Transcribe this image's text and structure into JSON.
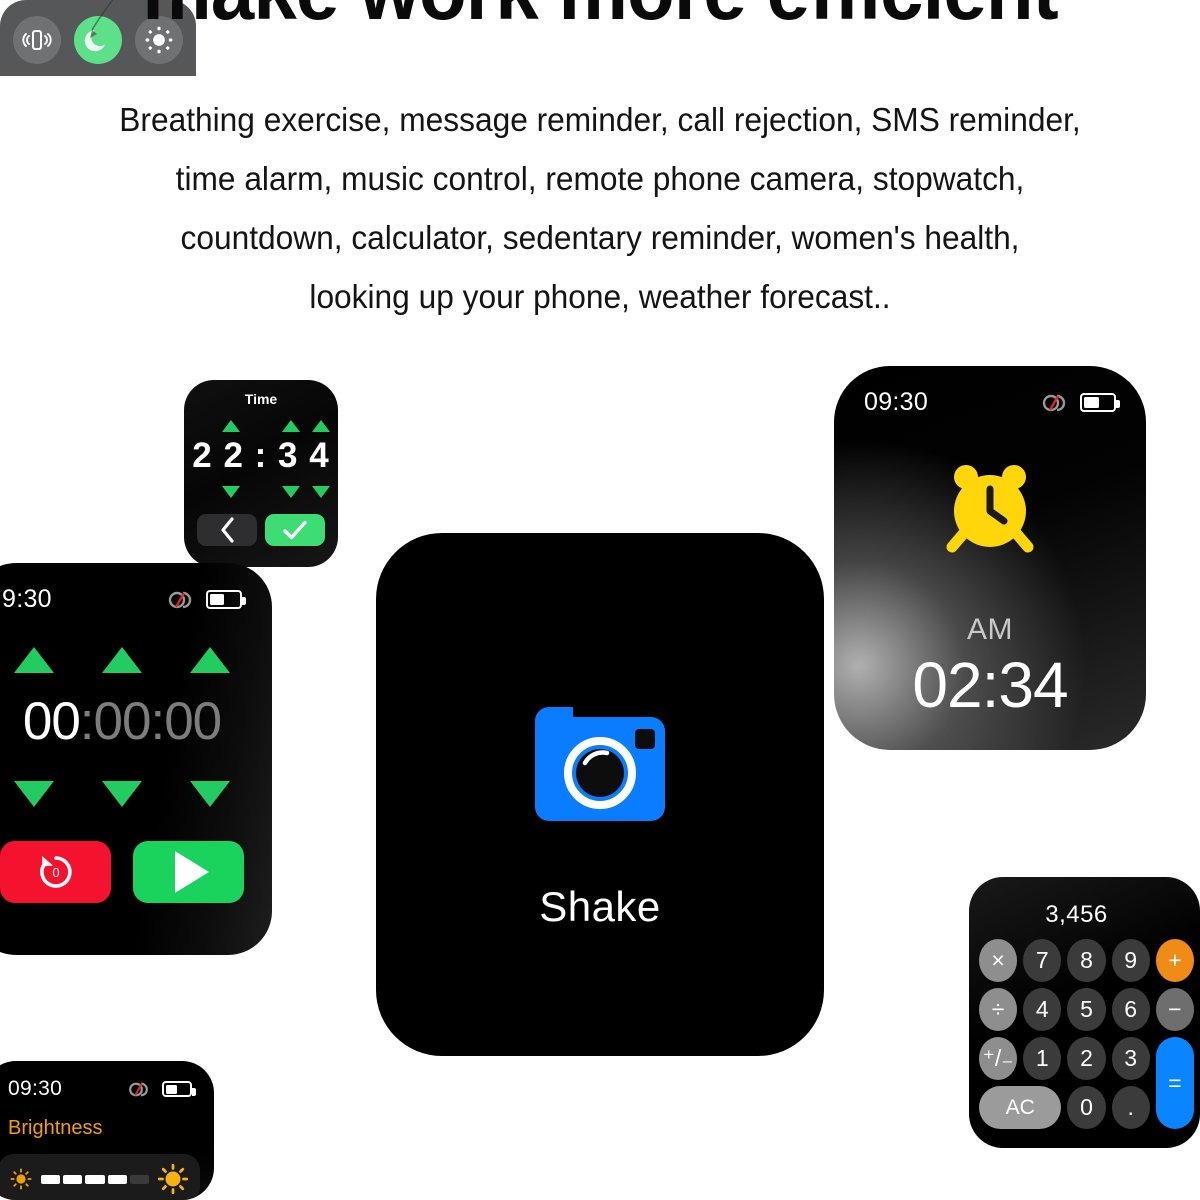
{
  "headline": "make work more efficient",
  "subcopy_lines": [
    "Breathing exercise, message reminder, call rejection, SMS reminder,",
    "time alarm,  music control, remote phone camera, stopwatch,",
    "countdown, calculator, sedentary reminder, women's health,",
    "looking up your phone, weather forecast.."
  ],
  "colors": {
    "green": "#22cc61",
    "green_button": "#19d35c",
    "red_button": "#f5122e",
    "alarm_yellow": "#FFD60A",
    "camera_blue": "#0a7cff",
    "calc_orange": "#f08b16",
    "calc_blue": "#0a84ff",
    "brightness_amber": "#f0a000"
  },
  "time_picker": {
    "title": "Time",
    "digits": "2 2 : 3 4",
    "up_arrow_icon": "triangle-up-icon",
    "down_arrow_icon": "triangle-down-icon",
    "back_icon": "chevron-left-icon",
    "confirm_icon": "check-icon"
  },
  "timer": {
    "status_time": "9:30",
    "bluetooth_icon": "bluetooth-disconnected-icon",
    "battery_icon": "battery-half-icon",
    "digits_active": "00",
    "digits_rest": ":00:00",
    "up_arrow_icon": "triangle-up-icon",
    "down_arrow_icon": "triangle-down-icon",
    "reset_icon": "reset-zero-icon",
    "play_icon": "play-icon"
  },
  "alarm": {
    "status_time": "09:30",
    "bluetooth_icon": "bluetooth-disconnected-icon",
    "battery_icon": "battery-half-icon",
    "alarm_icon": "alarm-clock-icon",
    "meridiem": "AM",
    "time": "02:34"
  },
  "shake": {
    "camera_icon": "camera-icon",
    "label": "Shake"
  },
  "calculator": {
    "display": "3,456",
    "keys": [
      {
        "label": "×",
        "style": "k-fn",
        "name": "multiply"
      },
      {
        "label": "7",
        "style": "k-num",
        "name": "7"
      },
      {
        "label": "8",
        "style": "k-num",
        "name": "8"
      },
      {
        "label": "9",
        "style": "k-num",
        "name": "9"
      },
      {
        "label": "+",
        "style": "k-plus",
        "name": "plus"
      },
      {
        "label": "÷",
        "style": "k-fn",
        "name": "divide"
      },
      {
        "label": "4",
        "style": "k-num",
        "name": "4"
      },
      {
        "label": "5",
        "style": "k-num",
        "name": "5"
      },
      {
        "label": "6",
        "style": "k-num",
        "name": "6"
      },
      {
        "label": "−",
        "style": "k-minus",
        "name": "minus"
      },
      {
        "label": "⁺/₋",
        "style": "k-fn",
        "name": "plus-minus"
      },
      {
        "label": "1",
        "style": "k-num",
        "name": "1"
      },
      {
        "label": "2",
        "style": "k-num",
        "name": "2"
      },
      {
        "label": "3",
        "style": "k-num",
        "name": "3"
      },
      {
        "label": "=",
        "style": "k-eq",
        "name": "equals"
      },
      {
        "label": "AC",
        "style": "k-ac",
        "name": "all-clear"
      },
      {
        "label": "0",
        "style": "k-num",
        "name": "0"
      },
      {
        "label": ".",
        "style": "k-num",
        "name": "decimal"
      }
    ]
  },
  "brightness": {
    "status_time": "09:30",
    "bluetooth_icon": "bluetooth-disconnected-icon",
    "battery_icon": "battery-half-icon",
    "title": "Brightness",
    "low_icon": "sun-small-icon",
    "high_icon": "sun-large-icon",
    "segments_total": 5,
    "segments_filled": 4
  },
  "quick_panel": {
    "items": [
      {
        "icon": "vibrate-phone-icon",
        "active": false
      },
      {
        "icon": "moon-icon",
        "active": true
      },
      {
        "icon": "brightness-sun-icon",
        "active": false
      }
    ]
  }
}
